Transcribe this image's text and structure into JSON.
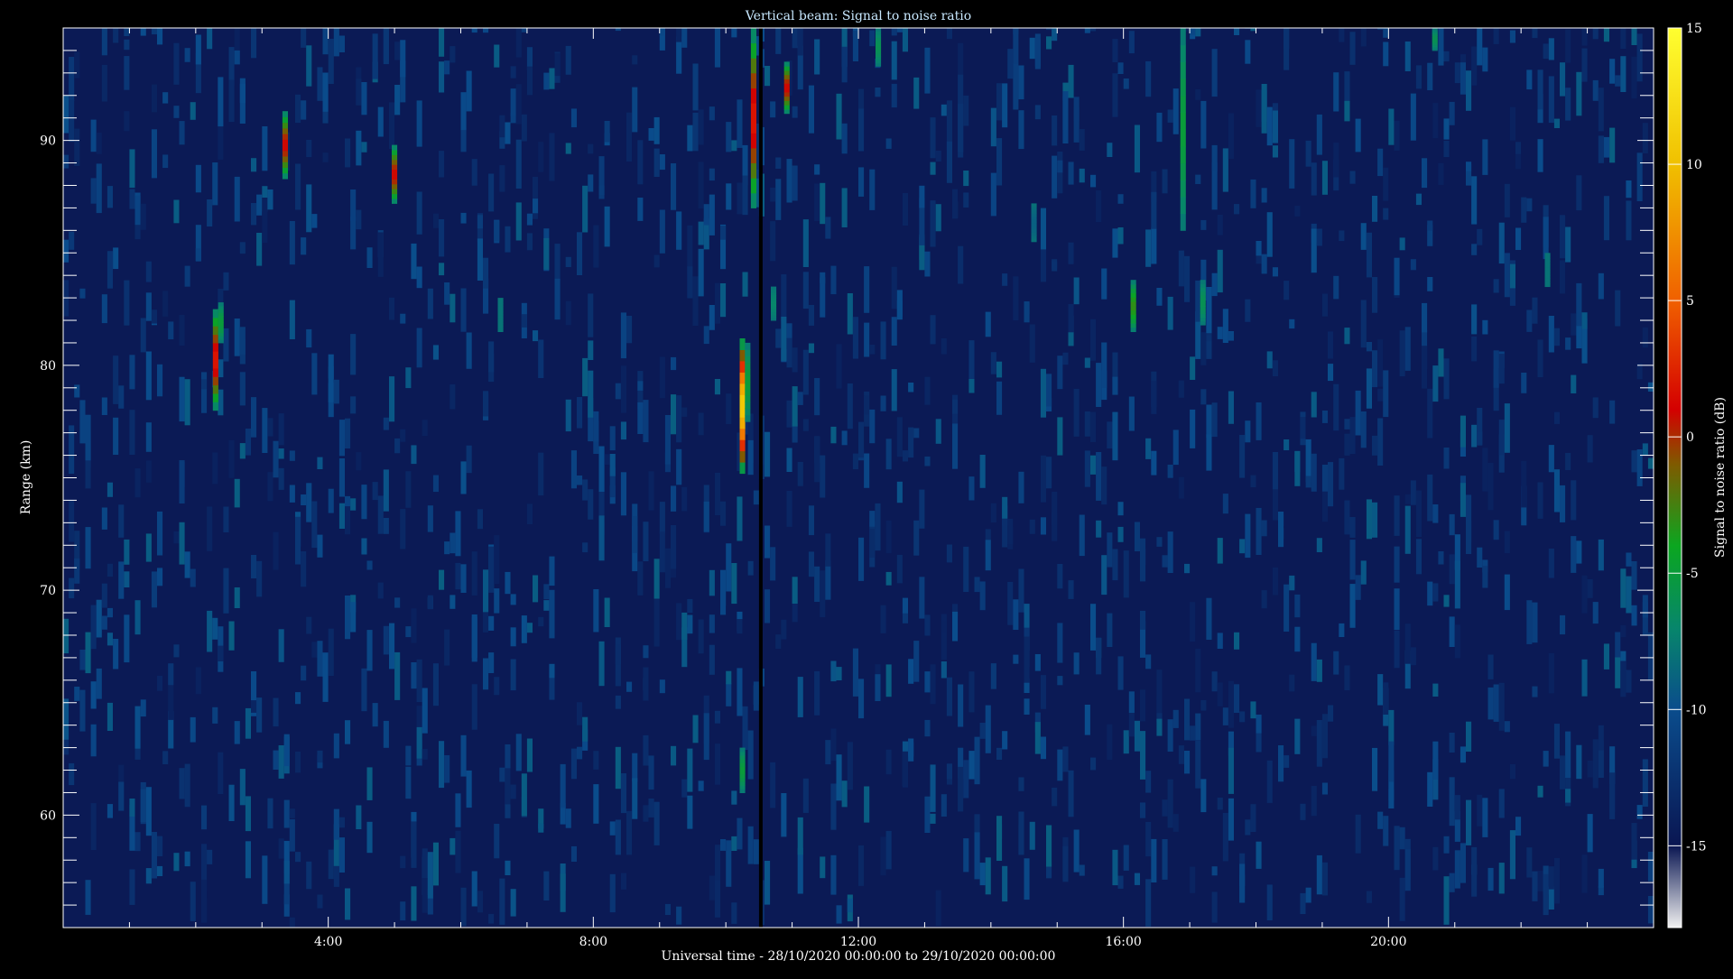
{
  "chart_data": {
    "type": "heatmap",
    "title": "Vertical beam: Signal to noise ratio",
    "xlabel": "Universal time - 28/10/2020 00:00:00 to 29/10/2020 00:00:00",
    "ylabel": "Range (km)",
    "colorbar_label": "Signal to noise ratio (dB)",
    "x_unit": "hours UT",
    "xlim": [
      0,
      24
    ],
    "ylim": [
      55,
      95
    ],
    "x_ticks": [
      {
        "value": 4,
        "label": "4:00"
      },
      {
        "value": 8,
        "label": "8:00"
      },
      {
        "value": 12,
        "label": "12:00"
      },
      {
        "value": 16,
        "label": "16:00"
      },
      {
        "value": 20,
        "label": "20:00"
      }
    ],
    "y_ticks": [
      {
        "value": 60,
        "label": "60"
      },
      {
        "value": 70,
        "label": "70"
      },
      {
        "value": 80,
        "label": "80"
      },
      {
        "value": 90,
        "label": "90"
      }
    ],
    "colorbar": {
      "range": [
        -18,
        15
      ],
      "ticks": [
        {
          "value": 15,
          "label": "15"
        },
        {
          "value": 10,
          "label": "10"
        },
        {
          "value": 5,
          "label": "5"
        },
        {
          "value": 0,
          "label": "0"
        },
        {
          "value": -5,
          "label": "-5"
        },
        {
          "value": -10,
          "label": "-10"
        },
        {
          "value": -15,
          "label": "-15"
        }
      ]
    },
    "background_snr_db": -15,
    "gap_time": 10.5,
    "echoes": [
      {
        "time": 2.3,
        "range_min": 78.0,
        "range_max": 82.5,
        "snr_peak": 2
      },
      {
        "time": 2.38,
        "range_min": 81.0,
        "range_max": 82.8,
        "snr_peak": -5
      },
      {
        "time": 3.35,
        "range_min": 88.3,
        "range_max": 91.3,
        "snr_peak": 1
      },
      {
        "time": 5.0,
        "range_min": 87.2,
        "range_max": 89.8,
        "snr_peak": 1
      },
      {
        "time": 6.6,
        "range_min": 81.5,
        "range_max": 83.0,
        "snr_peak": -8
      },
      {
        "time": 10.25,
        "range_min": 75.2,
        "range_max": 81.2,
        "snr_peak": 11
      },
      {
        "time": 10.33,
        "range_min": 77.5,
        "range_max": 81.0,
        "snr_peak": -5
      },
      {
        "time": 10.42,
        "range_min": 87.0,
        "range_max": 95.0,
        "snr_peak": 2
      },
      {
        "time": 10.25,
        "range_min": 61.0,
        "range_max": 63.0,
        "snr_peak": -5
      },
      {
        "time": 10.72,
        "range_min": 82.0,
        "range_max": 83.5,
        "snr_peak": -7
      },
      {
        "time": 10.92,
        "range_min": 91.2,
        "range_max": 93.5,
        "snr_peak": 1
      },
      {
        "time": 12.3,
        "range_min": 93.3,
        "range_max": 95.0,
        "snr_peak": -6
      },
      {
        "time": 14.65,
        "range_min": 85.5,
        "range_max": 87.2,
        "snr_peak": -9
      },
      {
        "time": 16.15,
        "range_min": 81.5,
        "range_max": 83.8,
        "snr_peak": -3
      },
      {
        "time": 16.9,
        "range_min": 86.0,
        "range_max": 95.0,
        "snr_peak": -5
      },
      {
        "time": 17.2,
        "range_min": 81.8,
        "range_max": 83.8,
        "snr_peak": -6
      },
      {
        "time": 20.7,
        "range_min": 94.0,
        "range_max": 95.0,
        "snr_peak": -6
      },
      {
        "time": 22.4,
        "range_min": 83.5,
        "range_max": 85.0,
        "snr_peak": -8
      }
    ],
    "grid": false,
    "colormap_stops": [
      {
        "value": -18,
        "color": "#f0f0f0"
      },
      {
        "value": -15,
        "color": "#0a1652"
      },
      {
        "value": -10,
        "color": "#0a4c8c"
      },
      {
        "value": -7,
        "color": "#07866b"
      },
      {
        "value": -4,
        "color": "#0ba620"
      },
      {
        "value": -1,
        "color": "#7f5a00"
      },
      {
        "value": 1,
        "color": "#d40000"
      },
      {
        "value": 5,
        "color": "#f06000"
      },
      {
        "value": 10,
        "color": "#f0c000"
      },
      {
        "value": 15,
        "color": "#ffff30"
      }
    ]
  }
}
